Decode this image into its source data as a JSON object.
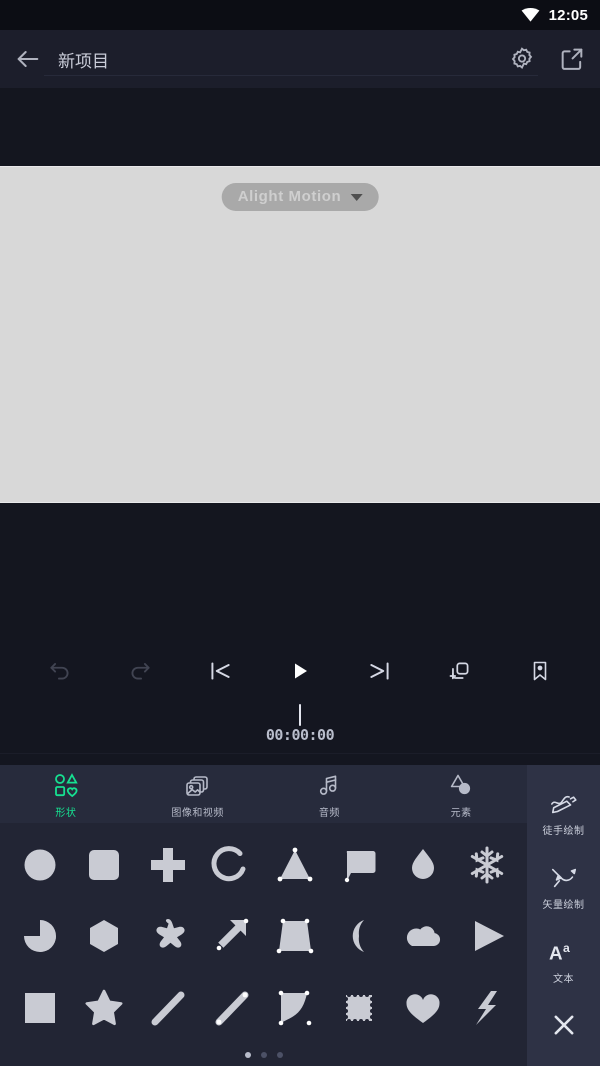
{
  "status_bar": {
    "time": "12:05",
    "wifi_icon": "wifi-icon"
  },
  "app_bar": {
    "back_icon": "back-arrow-icon",
    "project_title": "新项目",
    "settings_icon": "gear-icon",
    "export_icon": "export-icon"
  },
  "preview": {
    "watermark_text": "Alight Motion",
    "watermark_caret_icon": "chevron-down-icon",
    "canvas_color": "#d8d8d8",
    "background_color": "#14161f"
  },
  "transport": {
    "buttons": [
      {
        "name": "undo-button",
        "icon": "undo-icon",
        "enabled": false
      },
      {
        "name": "redo-button",
        "icon": "redo-icon",
        "enabled": false
      },
      {
        "name": "skip-to-start-button",
        "icon": "skip-to-start-icon",
        "enabled": true
      },
      {
        "name": "play-button",
        "icon": "play-icon",
        "enabled": true
      },
      {
        "name": "skip-to-end-button",
        "icon": "skip-to-end-icon",
        "enabled": true
      },
      {
        "name": "add-layer-button",
        "icon": "duplicate-layer-icon",
        "enabled": true
      },
      {
        "name": "bookmark-button",
        "icon": "bookmark-icon",
        "enabled": true
      }
    ]
  },
  "timeline": {
    "timecode": "00:00:00",
    "playhead_position": "center"
  },
  "panel": {
    "tabs": [
      {
        "label": "形状",
        "icon": "shapes-icon",
        "active": true
      },
      {
        "label": "图像和视频",
        "icon": "media-icon",
        "active": false
      },
      {
        "label": "音频",
        "icon": "audio-note-icon",
        "active": false
      },
      {
        "label": "元素",
        "icon": "elements-icon",
        "active": false
      }
    ],
    "active_tab_color": "#16e191",
    "shapes": [
      {
        "name": "circle",
        "icon": "circle-shape-icon"
      },
      {
        "name": "rounded-square",
        "icon": "rounded-square-shape-icon"
      },
      {
        "name": "cross",
        "icon": "cross-shape-icon"
      },
      {
        "name": "arc",
        "icon": "arc-shape-icon"
      },
      {
        "name": "triangle",
        "icon": "triangle-shape-icon"
      },
      {
        "name": "speech-bubble",
        "icon": "speech-bubble-shape-icon"
      },
      {
        "name": "droplet",
        "icon": "droplet-shape-icon"
      },
      {
        "name": "snowflake",
        "icon": "snowflake-shape-icon"
      },
      {
        "name": "pie",
        "icon": "pie-shape-icon"
      },
      {
        "name": "hexagon",
        "icon": "hexagon-shape-icon"
      },
      {
        "name": "flower-star",
        "icon": "flower-star-shape-icon"
      },
      {
        "name": "arrow",
        "icon": "arrow-shape-icon"
      },
      {
        "name": "trapezoid",
        "icon": "trapezoid-shape-icon"
      },
      {
        "name": "crescent-moon",
        "icon": "crescent-moon-shape-icon"
      },
      {
        "name": "cloud",
        "icon": "cloud-shape-icon"
      },
      {
        "name": "play-triangle",
        "icon": "play-triangle-shape-icon"
      },
      {
        "name": "square",
        "icon": "square-shape-icon"
      },
      {
        "name": "star",
        "icon": "star-shape-icon"
      },
      {
        "name": "thick-line",
        "icon": "thick-line-shape-icon"
      },
      {
        "name": "line-segment",
        "icon": "line-segment-shape-icon"
      },
      {
        "name": "curved-corner",
        "icon": "curved-corner-shape-icon"
      },
      {
        "name": "stamp",
        "icon": "stamp-shape-icon"
      },
      {
        "name": "heart",
        "icon": "heart-shape-icon"
      },
      {
        "name": "lightning-bolt",
        "icon": "lightning-bolt-shape-icon"
      }
    ],
    "page_dots": {
      "count": 3,
      "active_index": 0
    }
  },
  "side_rail": {
    "items": [
      {
        "label": "徒手绘制",
        "icon": "freehand-draw-icon"
      },
      {
        "label": "矢量绘制",
        "icon": "vector-draw-icon"
      },
      {
        "label": "文本",
        "icon": "text-aa-icon"
      }
    ],
    "close_icon": "close-icon"
  }
}
